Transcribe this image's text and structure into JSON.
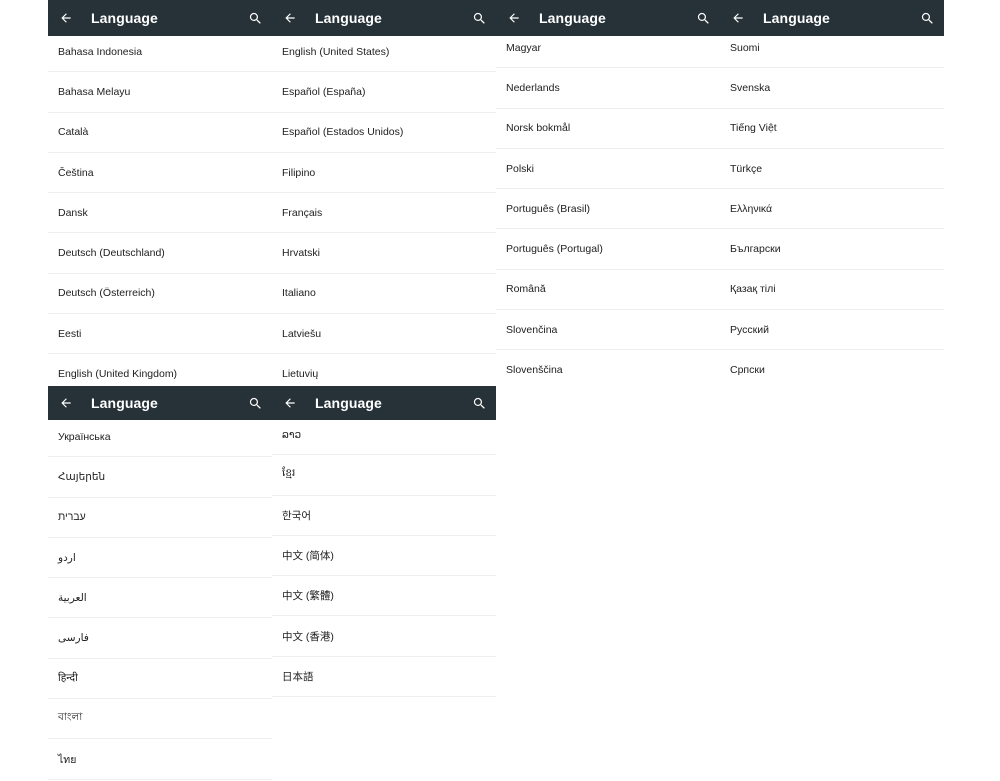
{
  "panels": [
    {
      "title": "Language",
      "items": [
        "Bahasa Indonesia",
        "Bahasa Melayu",
        "Català",
        "Čeština",
        "Dansk",
        "Deutsch (Deutschland)",
        "Deutsch (Österreich)",
        "Eesti",
        "English (United Kingdom)"
      ]
    },
    {
      "title": "Language",
      "items": [
        "English (United States)",
        "Español (España)",
        "Español (Estados Unidos)",
        "Filipino",
        "Français",
        "Hrvatski",
        "Italiano",
        "Latviešu",
        "Lietuvių"
      ]
    },
    {
      "title": "Language",
      "items": [
        "Magyar",
        "Nederlands",
        "Norsk bokmål",
        "Polski",
        "Português (Brasil)",
        "Português (Portugal)",
        "Română",
        "Slovenčina",
        "Slovenščina"
      ]
    },
    {
      "title": "Language",
      "items": [
        "Suomi",
        "Svenska",
        "Tiếng Việt",
        "Türkçe",
        "Ελληνικά",
        "Български",
        "Қазақ тілі",
        "Русский",
        "Српски"
      ]
    },
    {
      "title": "Language",
      "items": [
        "Українська",
        "Հայերեն",
        "עברית",
        "اردو",
        "العربية",
        "فارسی",
        "हिन्दी",
        "বাংলা",
        "ไทย"
      ]
    },
    {
      "title": "Language",
      "items": [
        "ລາວ",
        "ខ្មែរ",
        "한국어",
        "中文 (简体)",
        "中文 (繁體)",
        "中文 (香港)",
        "日本語"
      ]
    }
  ],
  "icons": {
    "back": "arrow-back-icon",
    "search": "search-icon"
  },
  "colors": {
    "appbar": "#263238",
    "appbar_text": "#ffffff",
    "divider": "#eeeeee",
    "text": "#212121"
  }
}
